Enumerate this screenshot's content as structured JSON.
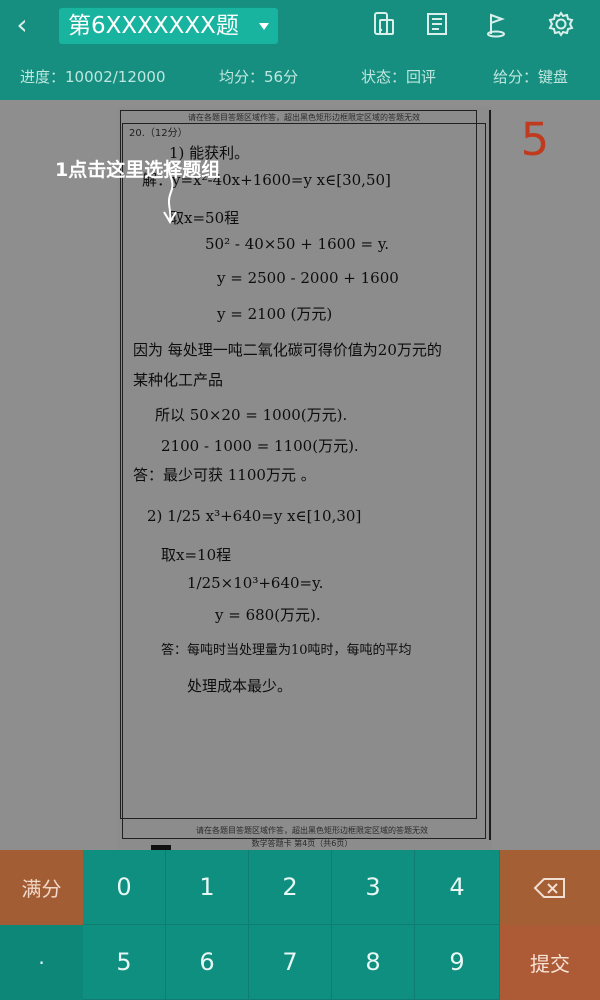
{
  "header": {
    "back_icon": "chevron-left-icon",
    "title": "第6XXXXXXX题",
    "caret_icon": "caret-down-icon",
    "icons": [
      "phone-icon",
      "document-icon",
      "flag-icon",
      "gear-icon"
    ]
  },
  "status": {
    "progress_label": "进度：",
    "progress_value": "10002/12000",
    "average_label": "均分：",
    "average_value": "56分",
    "state_label": "状态：",
    "state_value": "回评",
    "score_mode_label": "给分：",
    "score_mode_value": "键盘"
  },
  "answer_sheet": {
    "header_text": "请在各题目答题区域作答，超出黑色矩形边框限定区域的答题无效",
    "footer_text": "请在各题目答题区域作答，超出黑色矩形边框限定区域的答题无效",
    "page_text": "数学答题卡   第4页（共6页）",
    "question": "20.（12分）",
    "handwriting": [
      "1) 能获利。",
      "解：y=x²-40x+1600=y    x∈[30,50]",
      "取x=50程",
      "50² - 40×50 + 1600 = y.",
      "y = 2500 - 2000 + 1600",
      "y = 2100 (万元)",
      "因为 每处理一吨二氧化碳可得价值为20万元的",
      "某种化工产品",
      "所以 50×20 = 1000(万元).",
      "2100 - 1000 = 1100(万元).",
      "答：最少可获 1100万元 。",
      "2) 1/25 x³+640=y  x∈[10,30]",
      "取x=10程",
      "1/25×10³+640=y.",
      "y = 680(万元).",
      "答：每吨时当处理量为10吨时，每吨的平均",
      "处理成本最少。"
    ],
    "annotation": "1点击这里选择题组",
    "score": "5"
  },
  "keypad": {
    "full_score": "满分",
    "dot": "·",
    "digits_row1": [
      "0",
      "1",
      "2",
      "3",
      "4"
    ],
    "digits_row2": [
      "5",
      "6",
      "7",
      "8",
      "9"
    ],
    "backspace_icon": "backspace-icon",
    "submit": "提交"
  },
  "colors": {
    "top": "#168f80",
    "title_button": "#18b4a0",
    "keypad": "#0e8f80",
    "score": "#c03a1f",
    "accent": "#a35d34"
  }
}
